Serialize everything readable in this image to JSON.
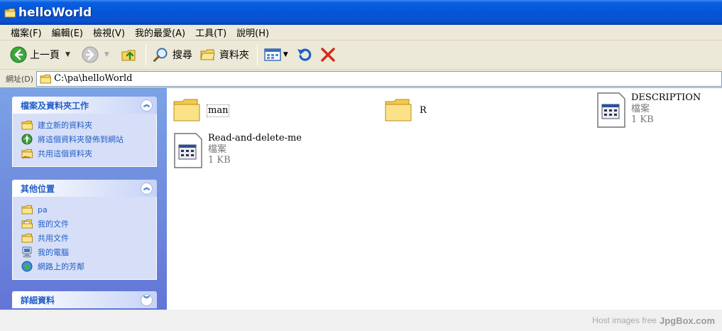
{
  "window": {
    "title": "helloWorld"
  },
  "menu": [
    "檔案(F)",
    "編輯(E)",
    "檢視(V)",
    "我的最愛(A)",
    "工具(T)",
    "說明(H)"
  ],
  "toolbar": {
    "back_label": "上一頁",
    "search_label": "搜尋",
    "folders_label": "資料夾"
  },
  "address": {
    "label": "網址(D)",
    "path": "C:\\pa\\helloWorld"
  },
  "tasks": {
    "title": "檔案及資料夾工作",
    "items": [
      {
        "label": "建立新的資料夾",
        "icon": "new-folder-icon"
      },
      {
        "label": "將這個資料夾發佈到網站",
        "icon": "publish-web-icon"
      },
      {
        "label": "共用這個資料夾",
        "icon": "share-folder-icon"
      }
    ]
  },
  "places": {
    "title": "其他位置",
    "items": [
      {
        "label": "pa",
        "icon": "folder-icon"
      },
      {
        "label": "我的文件",
        "icon": "my-documents-icon"
      },
      {
        "label": "共用文件",
        "icon": "shared-documents-icon"
      },
      {
        "label": "我的電腦",
        "icon": "my-computer-icon"
      },
      {
        "label": "網路上的芳鄰",
        "icon": "network-places-icon"
      }
    ]
  },
  "details": {
    "title": "詳細資料"
  },
  "files": [
    {
      "name": "man",
      "kind": "folder"
    },
    {
      "name": "R",
      "kind": "folder"
    },
    {
      "name": "DESCRIPTION",
      "kind": "file",
      "type": "檔案",
      "size": "1 KB"
    },
    {
      "name": "Read-and-delete-me",
      "kind": "file",
      "type": "檔案",
      "size": "1 KB"
    }
  ],
  "watermark": {
    "text1": "Host images free",
    "text2": "JpgBox.com"
  },
  "colors": {
    "titlebar": "#0454d8",
    "taskpane": "#6375d6",
    "link": "#215dc6",
    "chrome": "#ece9d8"
  }
}
